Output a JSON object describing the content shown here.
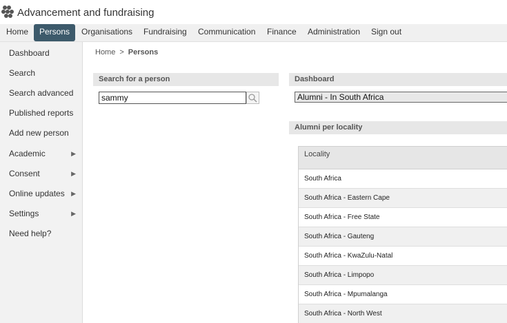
{
  "app": {
    "title": "Advancement and fundraising"
  },
  "nav": [
    {
      "label": "Home"
    },
    {
      "label": "Persons"
    },
    {
      "label": "Organisations"
    },
    {
      "label": "Fundraising"
    },
    {
      "label": "Communication"
    },
    {
      "label": "Finance"
    },
    {
      "label": "Administration"
    },
    {
      "label": "Sign out"
    }
  ],
  "nav_active": "Persons",
  "sidebar": {
    "items": [
      {
        "label": "Dashboard",
        "arrow": ""
      },
      {
        "label": "Search",
        "arrow": ""
      },
      {
        "label": "Search advanced",
        "arrow": ""
      },
      {
        "label": "Published reports",
        "arrow": ""
      },
      {
        "label": "Add new person",
        "arrow": ""
      },
      {
        "label": "Academic",
        "arrow": "▶"
      },
      {
        "label": "Consent",
        "arrow": "▶"
      },
      {
        "label": "Online updates",
        "arrow": "▶"
      },
      {
        "label": "Settings",
        "arrow": "▶"
      },
      {
        "label": "Need help?",
        "arrow": ""
      }
    ]
  },
  "breadcrumb": {
    "home": "Home",
    "separator": ">",
    "current": "Persons"
  },
  "search_panel": {
    "title": "Search for a person",
    "value": "sammy"
  },
  "dashboard_panel": {
    "title": "Dashboard",
    "selected": "Alumni - In South Africa"
  },
  "locality_panel": {
    "title": "Alumni per locality",
    "column": "Locality",
    "rows": [
      "South Africa",
      "South Africa - Eastern Cape",
      "South Africa - Free State",
      "South Africa - Gauteng",
      "South Africa - KwaZulu-Natal",
      "South Africa - Limpopo",
      "South Africa - Mpumalanga",
      "South Africa - North West"
    ]
  },
  "colors": {
    "nav_active_bg": "#3d5a6b",
    "panel_head_bg": "#e7e7e7"
  },
  "icons": {
    "logo": "dots-logo-icon",
    "search": "magnifier-icon"
  }
}
